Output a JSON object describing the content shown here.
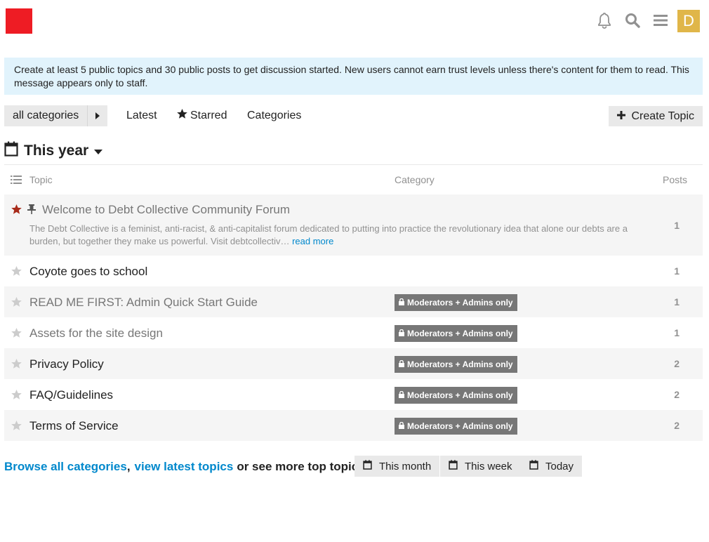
{
  "header": {
    "logo_color": "#ee1c24",
    "icons": [
      "bell-icon",
      "search-icon",
      "hamburger-icon"
    ],
    "avatar_letter": "D",
    "avatar_color": "#e0b649"
  },
  "notice": {
    "text": "Create at least 5 public topics and 30 public posts to get discussion started. New users cannot earn trust levels unless there's content for them to read. This message appears only to staff."
  },
  "nav": {
    "category_drop": "all categories",
    "latest": "Latest",
    "starred": "Starred",
    "categories": "Categories",
    "create_topic": "Create Topic"
  },
  "period": {
    "title": "This year"
  },
  "table": {
    "headers": {
      "topic": "Topic",
      "category": "Category",
      "posts": "Posts"
    },
    "rows": [
      {
        "title": "Welcome to Debt Collective Community Forum",
        "excerpt": "The Debt Collective is a feminist, anti-racist, & anti-capitalist forum dedicated to putting into practice the revolutionary idea that alone our debts are a burden, but together they make us powerful. Visit debtcollectiv…",
        "read_more": "read more",
        "category": "",
        "posts": "1",
        "starred": true,
        "pinned": true
      },
      {
        "title": "Coyote goes to school",
        "category": "",
        "posts": "1",
        "starred": false
      },
      {
        "title": "READ ME FIRST: Admin Quick Start Guide",
        "category": "Moderators + Admins only",
        "posts": "1",
        "starred": false
      },
      {
        "title": "Assets for the site design",
        "category": "Moderators + Admins only",
        "posts": "1",
        "starred": false
      },
      {
        "title": "Privacy Policy",
        "category": "Moderators + Admins only",
        "posts": "2",
        "starred": false
      },
      {
        "title": "FAQ/Guidelines",
        "category": "Moderators + Admins only",
        "posts": "2",
        "starred": false
      },
      {
        "title": "Terms of Service",
        "category": "Moderators + Admins only",
        "posts": "2",
        "starred": false
      }
    ]
  },
  "footer": {
    "browse": "Browse all categories",
    "comma": ",",
    "view_latest": "view latest topics",
    "or_more": "or see more top topics",
    "periods": [
      "This month",
      "This week",
      "Today"
    ]
  },
  "colors": {
    "link": "#0088cc",
    "starred": "#a82b1a",
    "notice_bg": "#e1f3fc",
    "badge_bg": "#777777"
  }
}
